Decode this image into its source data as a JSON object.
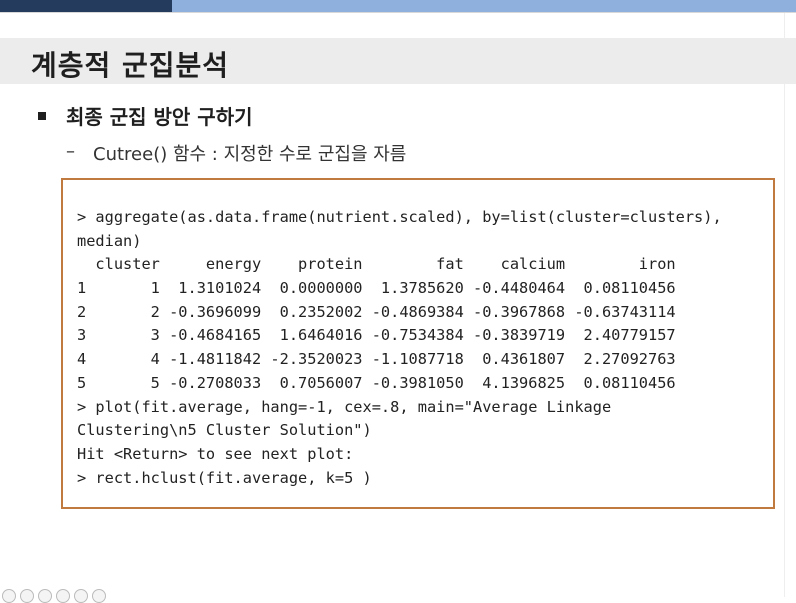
{
  "slide": {
    "title": "계층적 군집분석",
    "bullet1": "최종 군집 방안 구하기",
    "dash": "–",
    "bullet2": "Cutree() 함수 : 지정한 수로 군집을 자름"
  },
  "colors": {
    "top_bar_dark": "#243b5e",
    "top_bar_light": "#8fb0dd",
    "title_band": "#ececec",
    "code_border": "#c07a3f"
  },
  "console": {
    "lines": [
      "> aggregate(as.data.frame(nutrient.scaled), by=list(cluster=clusters),",
      "median)",
      "  cluster     energy    protein        fat    calcium        iron",
      "1       1  1.3101024  0.0000000  1.3785620 -0.4480464  0.08110456",
      "2       2 -0.3696099  0.2352002 -0.4869384 -0.3967868 -0.63743114",
      "3       3 -0.4684165  1.6464016 -0.7534384 -0.3839719  2.40779157",
      "4       4 -1.4811842 -2.3520023 -1.1087718  0.4361807  2.27092763",
      "5       5 -0.2708033  0.7056007 -0.3981050  4.1396825  0.08110456",
      "> plot(fit.average, hang=-1, cex=.8, main=\"Average Linkage",
      "Clustering\\n5 Cluster Solution\")",
      "Hit <Return> to see next plot:",
      "> rect.hclust(fit.average, k=5 )"
    ]
  },
  "toolbar_icons": [
    "back-icon",
    "forward-icon",
    "pen-icon",
    "slides-icon",
    "zoom-icon",
    "more-icon"
  ]
}
